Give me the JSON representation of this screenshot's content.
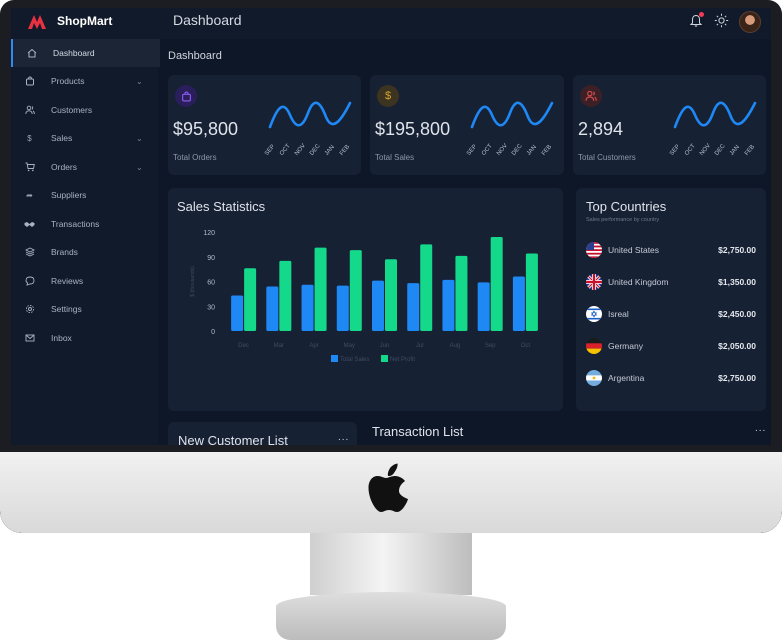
{
  "app": {
    "name": "ShopMart",
    "header_title": "Dashboard",
    "page_title": "Dashboard"
  },
  "sidebar": {
    "items": [
      {
        "label": "Dashboard",
        "icon": "home-icon",
        "active": true,
        "has_submenu": false
      },
      {
        "label": "Products",
        "icon": "bag-icon",
        "active": false,
        "has_submenu": true
      },
      {
        "label": "Customers",
        "icon": "users-icon",
        "active": false,
        "has_submenu": false
      },
      {
        "label": "Sales",
        "icon": "dollar-icon",
        "active": false,
        "has_submenu": true
      },
      {
        "label": "Orders",
        "icon": "cart-icon",
        "active": false,
        "has_submenu": true
      },
      {
        "label": "Suppliers",
        "icon": "share-icon",
        "active": false,
        "has_submenu": false
      },
      {
        "label": "Transactions",
        "icon": "handshake-icon",
        "active": false,
        "has_submenu": false
      },
      {
        "label": "Brands",
        "icon": "layers-icon",
        "active": false,
        "has_submenu": false
      },
      {
        "label": "Reviews",
        "icon": "chat-icon",
        "active": false,
        "has_submenu": false
      },
      {
        "label": "Settings",
        "icon": "gear-icon",
        "active": false,
        "has_submenu": false
      },
      {
        "label": "Inbox",
        "icon": "mail-icon",
        "active": false,
        "has_submenu": false
      }
    ]
  },
  "stats": [
    {
      "value": "$95,800",
      "label": "Total Orders",
      "icon": "bag-icon",
      "icon_color": "#8c5cf5",
      "icon_bg": "#2a1f5a"
    },
    {
      "value": "$195,800",
      "label": "Total Sales",
      "icon": "dollar-icon",
      "icon_color": "#d8a72c",
      "icon_bg": "#3c3320"
    },
    {
      "value": "2,894",
      "label": "Total Customers",
      "icon": "users-icon",
      "icon_color": "#e0504f",
      "icon_bg": "#3d2026"
    }
  ],
  "stat_months": [
    "SEP",
    "OCT",
    "NOV",
    "DEC",
    "JAN",
    "FEB"
  ],
  "sales_statistics": {
    "title": "Sales Statistics",
    "y_axis_label": "$ (thousands)",
    "y_ticks": [
      "120",
      "90",
      "60",
      "30",
      "0"
    ],
    "x_labels": [
      "Dec",
      "Mar",
      "Apr",
      "May",
      "Jun",
      "Jul",
      "Aug",
      "Sep",
      "Oct"
    ],
    "legend": [
      "Total Sales",
      "Net Profit"
    ]
  },
  "chart_data": {
    "type": "bar",
    "title": "Sales Statistics",
    "ylabel": "$ (thousands)",
    "ylim": [
      0,
      120
    ],
    "categories": [
      "Dec",
      "Mar",
      "Apr",
      "May",
      "Jun",
      "Jul",
      "Aug",
      "Sep",
      "Oct"
    ],
    "series": [
      {
        "name": "Total Sales",
        "color": "#1e88f5",
        "values": [
          43,
          54,
          56,
          55,
          61,
          58,
          62,
          59,
          66
        ]
      },
      {
        "name": "Net Profit",
        "color": "#14d98a",
        "values": [
          76,
          85,
          101,
          98,
          87,
          105,
          91,
          114,
          94
        ]
      }
    ],
    "grid": false,
    "legend_position": "bottom-center"
  },
  "top_countries": {
    "title": "Top Countries",
    "subtitle": "Sales performance by country",
    "rows": [
      {
        "name": "United States",
        "amount": "$2,750.00",
        "flag": "us-flag-icon"
      },
      {
        "name": "United Kingdom",
        "amount": "$1,350.00",
        "flag": "uk-flag-icon"
      },
      {
        "name": "Isreal",
        "amount": "$2,450.00",
        "flag": "israel-flag-icon"
      },
      {
        "name": "Germany",
        "amount": "$2,050.00",
        "flag": "germany-flag-icon"
      },
      {
        "name": "Argentina",
        "amount": "$2,750.00",
        "flag": "argentina-flag-icon"
      }
    ]
  },
  "new_customer_list": {
    "title": "New Customer List",
    "more": "..."
  },
  "transaction_list": {
    "title": "Transaction List",
    "more": "..."
  },
  "colors": {
    "accent": "#2f8af5",
    "wave": "#1e88f5",
    "bar1": "#1e88f5",
    "bar2": "#14d98a",
    "background": "#0e1727",
    "card": "#172134"
  }
}
